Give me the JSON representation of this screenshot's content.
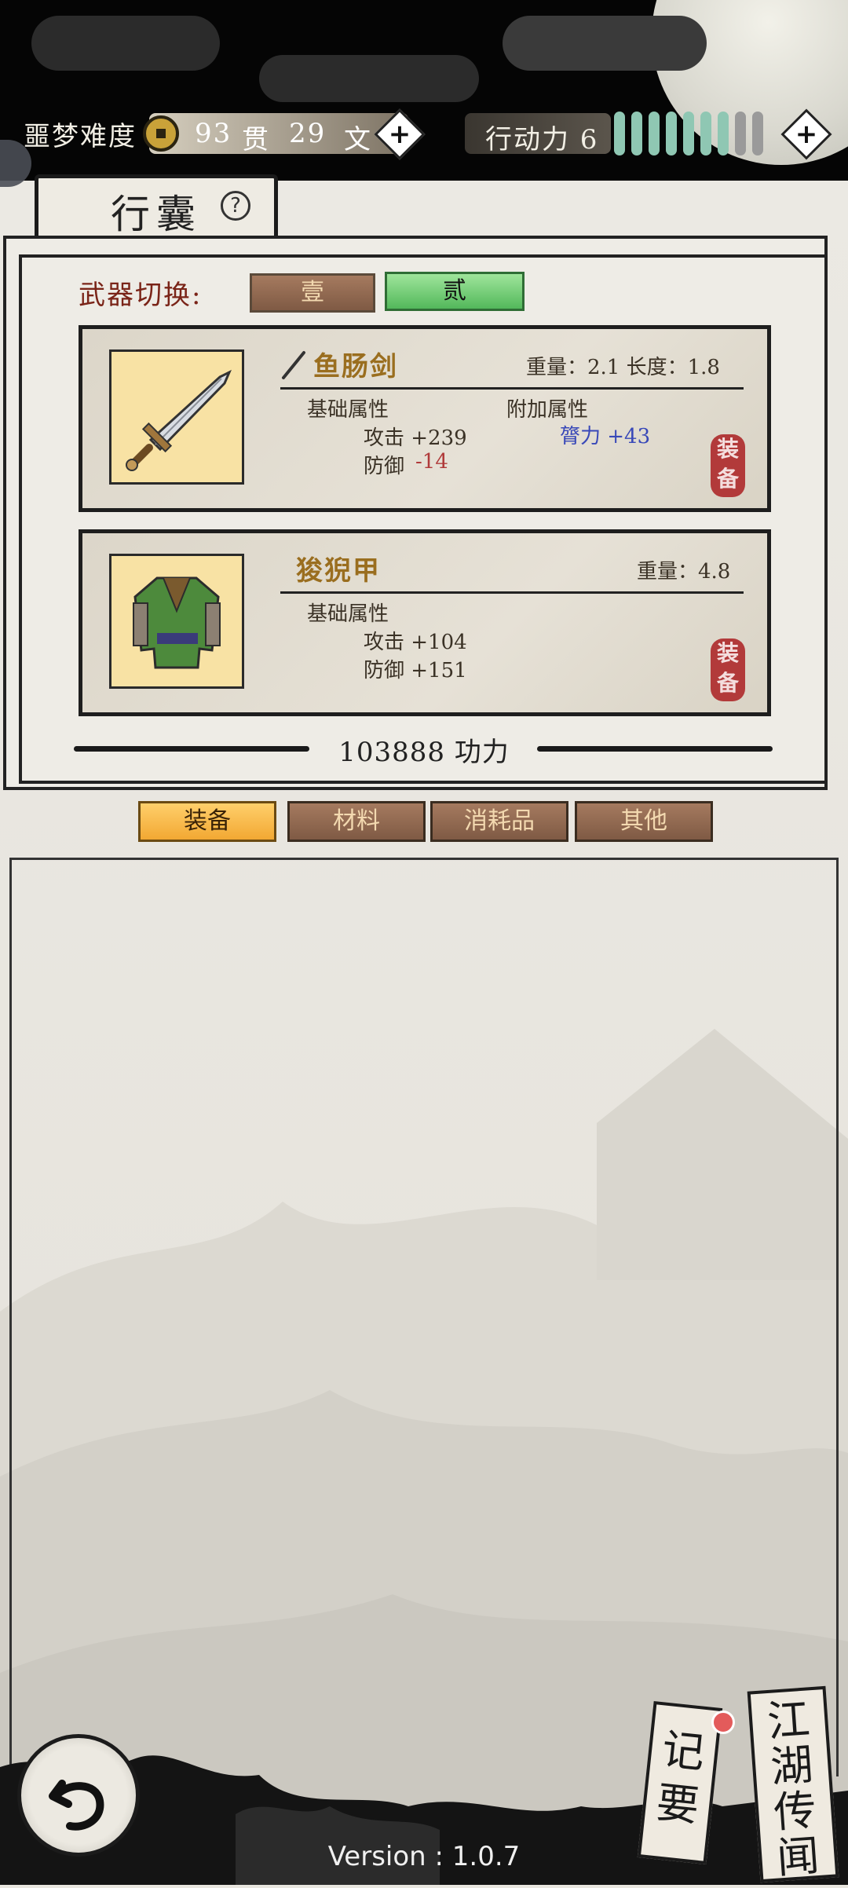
{
  "header": {
    "difficulty": "噩梦难度",
    "money_guan": "93",
    "guan_unit": "贯",
    "money_wen": "29",
    "wen_unit": "文",
    "action_label": "行动力 6",
    "energy_bars": 9,
    "energy_filled": 7
  },
  "inventory": {
    "title": "行囊",
    "help": "?",
    "weapon_switch_label": "武器切换:",
    "weapon_slots": [
      "壹",
      "贰"
    ],
    "items": [
      {
        "name": "鱼肠剑",
        "meta": "重量：2.1  长度：1.8",
        "base_label": "基础属性",
        "extra_label": "附加属性",
        "attack": "攻击 +239",
        "defense_label": "防御",
        "defense_value": "-14",
        "extra_stat": "膂力 +43",
        "equip": "装备"
      },
      {
        "name": "狻猊甲",
        "meta": "重量：4.8",
        "base_label": "基础属性",
        "attack": "攻击 +104",
        "defense": "防御 +151",
        "equip": "装备"
      }
    ],
    "power": "103888 功力",
    "categories": [
      "装备",
      "材料",
      "消耗品",
      "其他"
    ]
  },
  "footer": {
    "version": "Version : 1.0.7",
    "notes": "记要",
    "rumors": "江湖传闻"
  },
  "colors": {
    "accent_red": "#7a2418",
    "energy_on": "#8fc7b3",
    "energy_off": "#9a9a9a"
  }
}
